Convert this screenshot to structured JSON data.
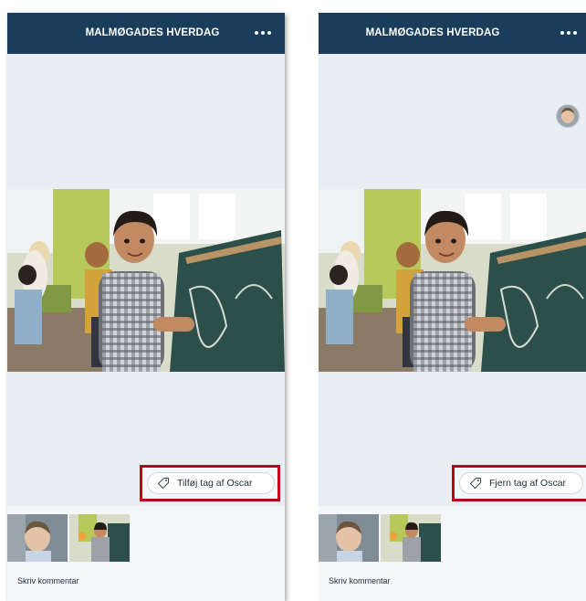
{
  "screens": [
    {
      "header_title": "MALMØGADES HVERDAG",
      "more_icon": "more-horizontal-icon",
      "tag_button_label": "Tilføj tag af Oscar",
      "tag_icon": "tag-icon",
      "comment_placeholder": "Skriv kommentar"
    },
    {
      "header_title": "MALMØGADES HVERDAG",
      "more_icon": "more-horizontal-icon",
      "tagged_avatar": "child-avatar",
      "tag_button_label": "Fjern tag af Oscar",
      "tag_icon": "tag-icon",
      "comment_placeholder": "Skriv kommentar"
    }
  ],
  "colors": {
    "header": "#1a3d5c",
    "highlight_border": "#c00018",
    "background": "#f4f6f9",
    "photo_area": "#e9eef3"
  }
}
